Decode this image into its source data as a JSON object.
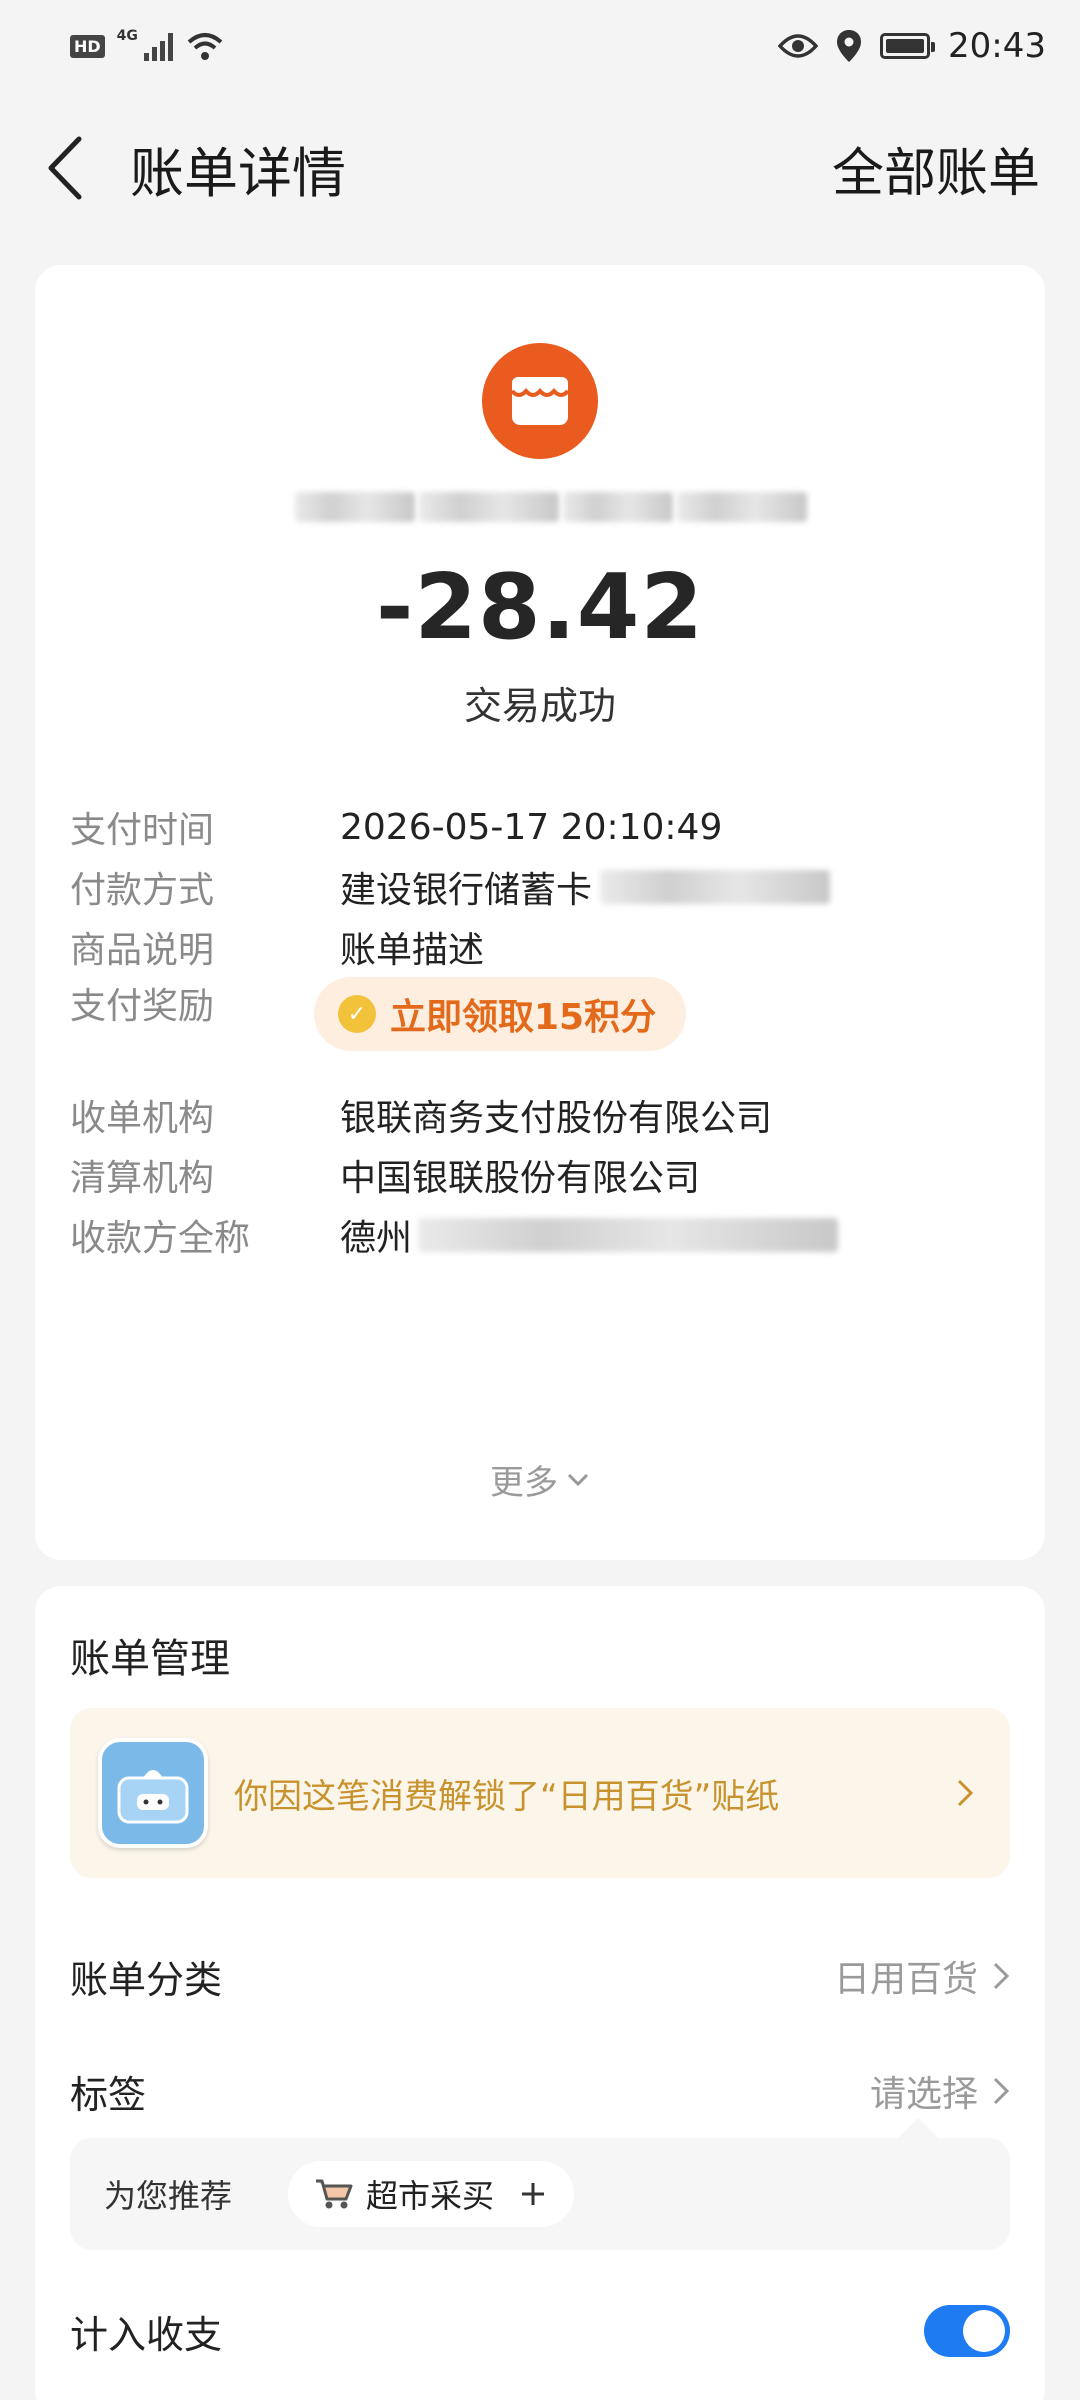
{
  "status_bar": {
    "hd": "HD",
    "network": "4G",
    "time": "20:43"
  },
  "header": {
    "title": "账单详情",
    "right_link": "全部账单"
  },
  "bill": {
    "amount": "-28.42",
    "status": "交易成功",
    "details": [
      {
        "label": "支付时间",
        "value": "2026-05-17 20:10:49"
      },
      {
        "label": "付款方式",
        "value": "建设银行储蓄卡"
      },
      {
        "label": "商品说明",
        "value": "账单描述"
      },
      {
        "label": "支付奖励",
        "value": "立即领取15积分"
      },
      {
        "label": "收单机构",
        "value": "银联商务支付股份有限公司"
      },
      {
        "label": "清算机构",
        "value": "中国银联股份有限公司"
      },
      {
        "label": "收款方全称",
        "value": "德州"
      }
    ],
    "more": "更多"
  },
  "manage": {
    "title": "账单管理",
    "sticker_text": "你因这笔消费解锁了“日用百货”贴纸",
    "category_label": "账单分类",
    "category_value": "日用百货",
    "tag_label": "标签",
    "tag_value": "请选择",
    "recommend_label": "为您推荐",
    "recommend_tag": "超市采买",
    "include_label": "计入收支",
    "include_on": true
  },
  "colors": {
    "merchant_icon": "#ea5b20",
    "reward_text": "#e46a1b",
    "sticker_text": "#c8922d",
    "toggle_on": "#1f7bf2"
  }
}
